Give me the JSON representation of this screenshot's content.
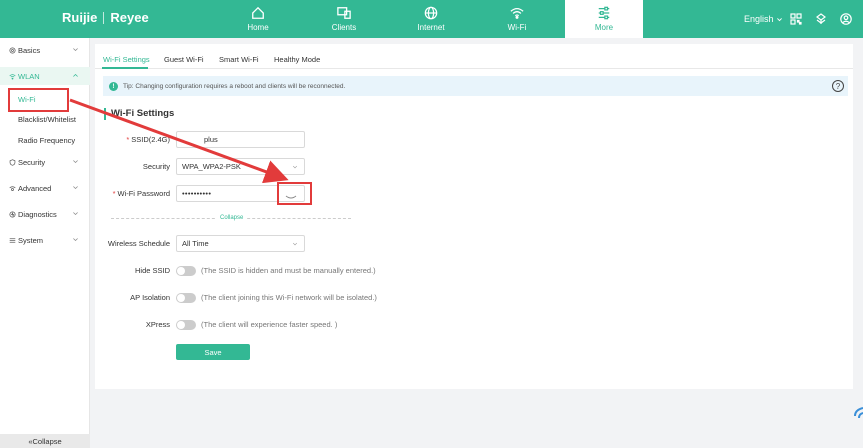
{
  "header": {
    "brand": "Ruijie",
    "brand_sub": "Reyee",
    "nav": [
      {
        "label": "Home",
        "icon": "home-icon"
      },
      {
        "label": "Clients",
        "icon": "clients-icon"
      },
      {
        "label": "Internet",
        "icon": "globe-icon"
      },
      {
        "label": "Wi-Fi",
        "icon": "wifi-icon"
      },
      {
        "label": "More",
        "icon": "sliders-icon"
      }
    ],
    "active_nav": "More",
    "language": "English"
  },
  "sidebar": {
    "items": [
      {
        "label": "Basics"
      },
      {
        "label": "WLAN"
      },
      {
        "label": "Wi-Fi"
      },
      {
        "label": "Blacklist/Whitelist"
      },
      {
        "label": "Radio Frequency"
      },
      {
        "label": "Security"
      },
      {
        "label": "Advanced"
      },
      {
        "label": "Diagnostics"
      },
      {
        "label": "System"
      }
    ],
    "collapse_label": "Collapse"
  },
  "tabs": [
    "Wi-Fi Settings",
    "Guest Wi-Fi",
    "Smart Wi-Fi",
    "Healthy Mode"
  ],
  "tip": "Tip: Changing configuration requires a reboot and clients will be reconnected.",
  "form": {
    "title": "Wi-Fi Settings",
    "ssid_label": "SSID(2.4G)",
    "ssid_value": "plus",
    "security_label": "Security",
    "security_value": "WPA_WPA2-PSK",
    "password_label": "Wi-Fi Password",
    "password_value": "••••••••••",
    "collapse_label": "Collapse",
    "schedule_label": "Wireless Schedule",
    "schedule_value": "All Time",
    "hide_ssid_label": "Hide SSID",
    "hide_ssid_hint": "(The SSID is hidden and must be manually entered.)",
    "ap_isolation_label": "AP Isolation",
    "ap_isolation_hint": "(The client joining this Wi-Fi network will be isolated.)",
    "xpress_label": "XPress",
    "xpress_hint": "(The client will experience faster speed. )",
    "save_label": "Save"
  },
  "colors": {
    "accent": "#33b894",
    "annotation": "#e23b3b"
  }
}
